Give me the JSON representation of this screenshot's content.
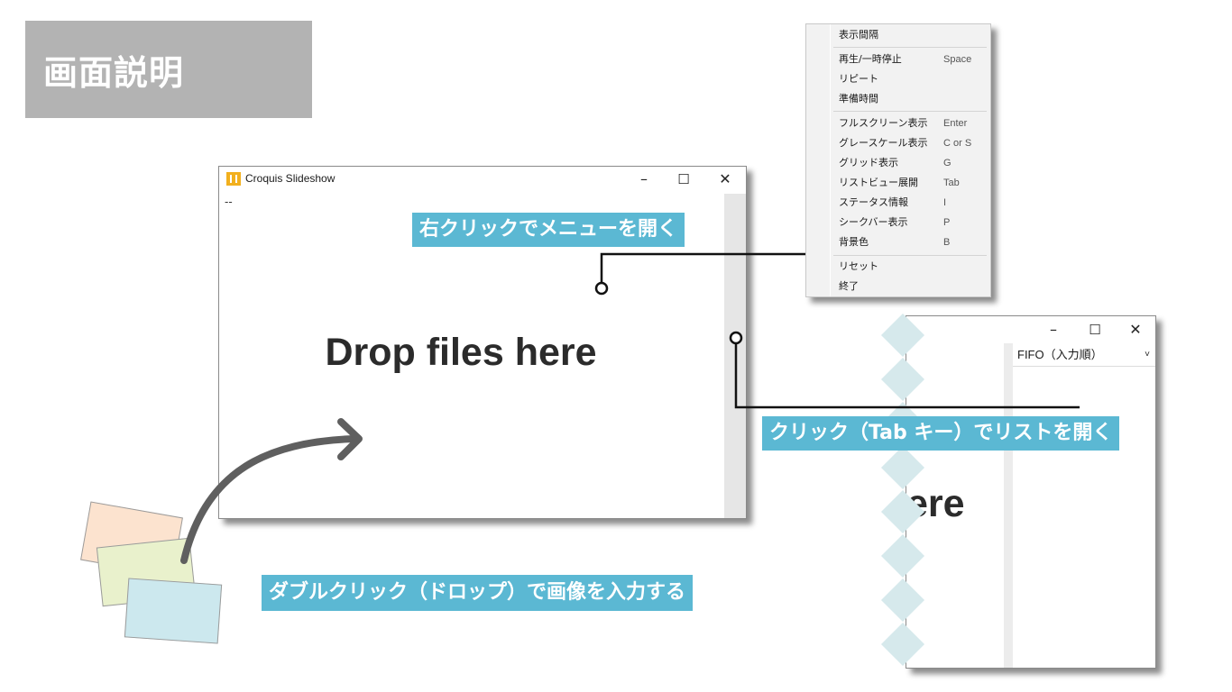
{
  "title": "画面説明",
  "main_window": {
    "title": "Croquis Slideshow",
    "status": "--",
    "drop_text": "Drop files here",
    "minimize": "–",
    "maximize": "☐",
    "close": "✕"
  },
  "context_menu": {
    "items": [
      {
        "label": "表示間隔",
        "shortcut": ""
      },
      {
        "label": "再生/一時停止",
        "shortcut": "Space"
      },
      {
        "label": "リピート",
        "shortcut": ""
      },
      {
        "label": "準備時間",
        "shortcut": ""
      },
      {
        "label": "フルスクリーン表示",
        "shortcut": "Enter"
      },
      {
        "label": "グレースケール表示",
        "shortcut": "C or S"
      },
      {
        "label": "グリッド表示",
        "shortcut": "G"
      },
      {
        "label": "リストビュー展開",
        "shortcut": "Tab"
      },
      {
        "label": "ステータス情報",
        "shortcut": "I"
      },
      {
        "label": "シークバー表示",
        "shortcut": "P"
      },
      {
        "label": "背景色",
        "shortcut": "B"
      },
      {
        "label": "リセット",
        "shortcut": ""
      },
      {
        "label": "終了",
        "shortcut": ""
      }
    ]
  },
  "list_window": {
    "select_value": "FIFO（入力順）",
    "chevron": "˅",
    "partial_text": "ere",
    "minimize": "–",
    "maximize": "☐",
    "close": "✕"
  },
  "annotations": {
    "right_click": "右クリックでメニューを開く",
    "list_open": "クリック（Tab キー）でリストを開く",
    "double_click": "ダブルクリック（ドロップ）で画像を入力する"
  },
  "colors": {
    "label_bg": "#5bb8d3",
    "title_bg": "#b3b3b3",
    "card_orange": "#fce3cf",
    "card_green": "#e9f1cc",
    "card_blue": "#cce8ee",
    "diamond": "#d6e9ec"
  }
}
